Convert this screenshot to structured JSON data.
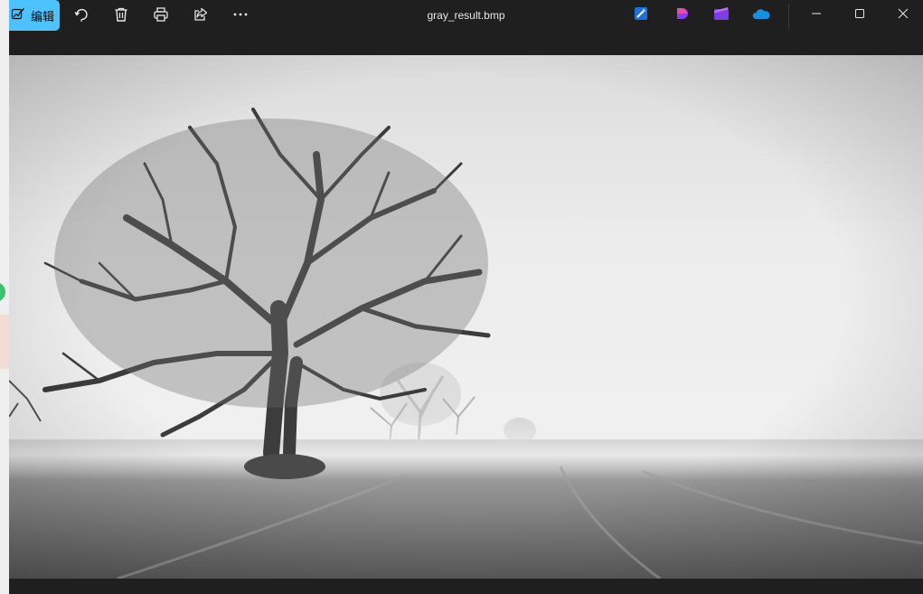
{
  "toolbar": {
    "edit_label": "编辑",
    "edit_icon": "edit-image-icon",
    "actions": [
      "rotate-icon",
      "delete-icon",
      "print-icon",
      "share-icon",
      "more-icon"
    ]
  },
  "window": {
    "title": "gray_result.bmp",
    "app_icons": [
      "designer-icon",
      "clipchamp-dot-icon",
      "clipchamp-icon",
      "onedrive-icon"
    ],
    "controls": [
      "minimize-icon",
      "maximize-icon",
      "close-icon"
    ]
  },
  "colors": {
    "accent": "#4cc2ff",
    "chrome": "#1f1f1f",
    "text": "#e8e8e8"
  },
  "image": {
    "content": "grayscale photo of tree in fog"
  }
}
